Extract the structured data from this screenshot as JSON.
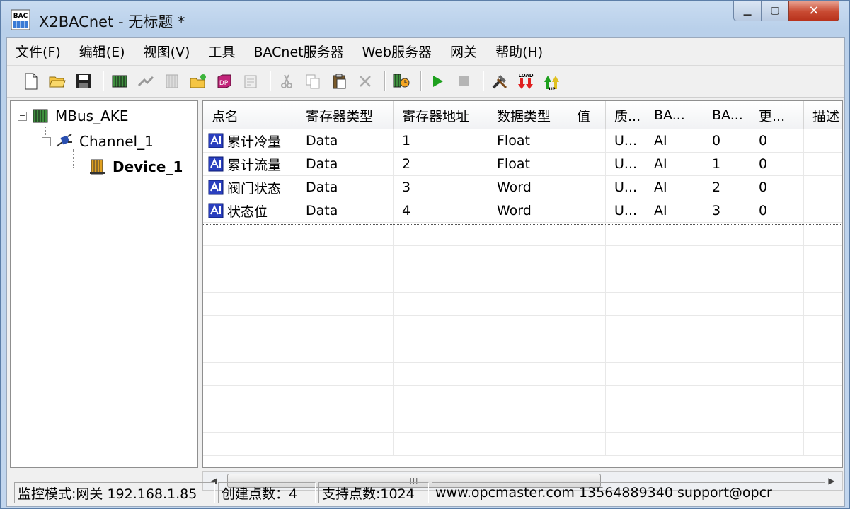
{
  "window": {
    "title": "X2BACnet - 无标题 *",
    "app_icon_text": "BAC"
  },
  "menu": [
    "文件(F)",
    "编辑(E)",
    "视图(V)",
    "工具",
    "BACnet服务器",
    "Web服务器",
    "网关",
    "帮助(H)"
  ],
  "toolbar": {
    "groups": [
      [
        "new-icon",
        "open-icon",
        "save-icon"
      ],
      [
        "add-device-icon",
        "add-channel-icon",
        "add-register-icon",
        "new-point-icon",
        "add-db-icon",
        "properties-icon"
      ],
      [
        "cut-icon",
        "copy-icon",
        "paste-icon",
        "delete-icon"
      ],
      [
        "monitor-icon"
      ],
      [
        "start-icon",
        "stop-icon"
      ],
      [
        "tools-icon",
        "load-icon",
        "up-icon"
      ]
    ],
    "load_label": "LOAD",
    "up_label": "UP"
  },
  "tree": {
    "root": "MBus_AKE",
    "channel": "Channel_1",
    "device": "Device_1"
  },
  "grid": {
    "columns": [
      "点名",
      "寄存器类型",
      "寄存器地址",
      "数据类型",
      "值",
      "质...",
      "BA...",
      "BA...",
      "更...",
      "描述"
    ],
    "rows": [
      [
        "累计冷量",
        "Data",
        "1",
        "Float",
        "",
        "U...",
        "AI",
        "0",
        "0",
        ""
      ],
      [
        "累计流量",
        "Data",
        "2",
        "Float",
        "",
        "U...",
        "AI",
        "1",
        "0",
        ""
      ],
      [
        "阀门状态",
        "Data",
        "3",
        "Word",
        "",
        "U...",
        "AI",
        "2",
        "0",
        ""
      ],
      [
        "状态位",
        "Data",
        "4",
        "Word",
        "",
        "U...",
        "AI",
        "3",
        "0",
        ""
      ]
    ]
  },
  "scrollbar": {
    "grip": "III"
  },
  "status": {
    "mode": "监控模式:网关 192.168.1.85",
    "count": "创建点数：4",
    "support": "支持点数:1024",
    "contact": "www.opcmaster.com 13564889340 support@opcr"
  }
}
